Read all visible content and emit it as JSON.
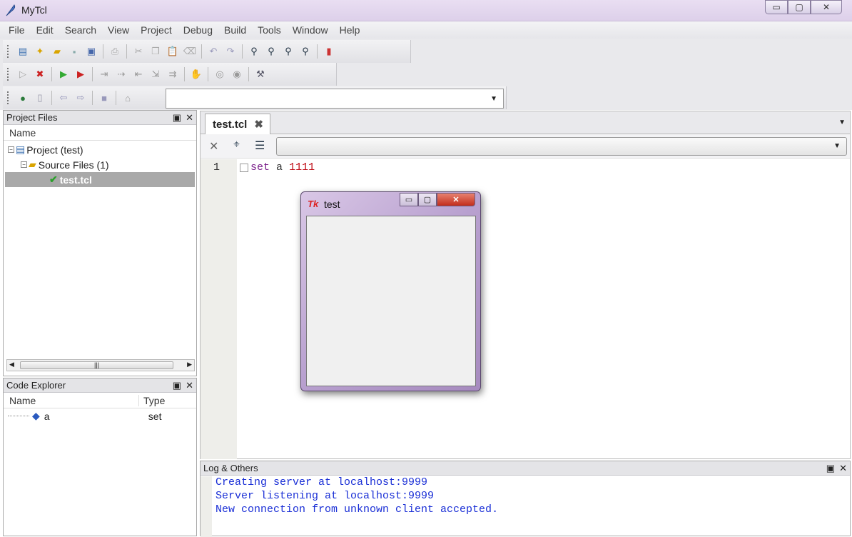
{
  "app": {
    "title": "MyTcl"
  },
  "menu": [
    "File",
    "Edit",
    "Search",
    "View",
    "Project",
    "Debug",
    "Build",
    "Tools",
    "Window",
    "Help"
  ],
  "project_panel": {
    "title": "Project Files",
    "column": "Name",
    "project": "Project (test)",
    "source_folder": "Source Files (1)",
    "file": "test.tcl"
  },
  "code_explorer": {
    "title": "Code Explorer",
    "columns": {
      "name": "Name",
      "type": "Type"
    },
    "rows": [
      {
        "name": "a",
        "type": "set"
      }
    ]
  },
  "editor": {
    "tab": "test.tcl",
    "line_number": "1",
    "code": {
      "keyword": "set",
      "var": "a",
      "value": "1111"
    }
  },
  "tk_window": {
    "title": "test",
    "logo": "Tk"
  },
  "log": {
    "title": "Log & Others",
    "lines": [
      "Creating server at localhost:9999",
      "Server listening at localhost:9999",
      "New connection from unknown client accepted."
    ]
  },
  "colors": {
    "log_text": "#1a2fd6",
    "keyword": "#7a1f8a",
    "number": "#c0101a"
  }
}
